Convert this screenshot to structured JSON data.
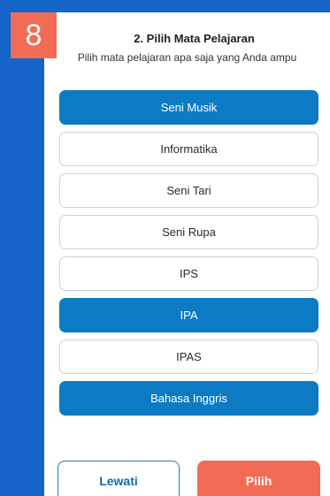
{
  "step": {
    "number": "8"
  },
  "header": {
    "title": "2. Pilih Mata Pelajaran",
    "subtitle": "Pilih mata pelajaran apa saja yang Anda ampu"
  },
  "subjects": [
    {
      "label": "Seni Musik",
      "selected": true
    },
    {
      "label": "Informatika",
      "selected": false
    },
    {
      "label": "Seni Tari",
      "selected": false
    },
    {
      "label": "Seni Rupa",
      "selected": false
    },
    {
      "label": "IPS",
      "selected": false
    },
    {
      "label": "IPA",
      "selected": true
    },
    {
      "label": "IPAS",
      "selected": false
    },
    {
      "label": "Bahasa Inggris",
      "selected": true
    }
  ],
  "actions": {
    "skip_label": "Lewati",
    "choose_label": "Pilih"
  },
  "colors": {
    "background_blue": "#1565c8",
    "selected_blue": "#0c7bc4",
    "accent_orange": "#f26b55"
  }
}
